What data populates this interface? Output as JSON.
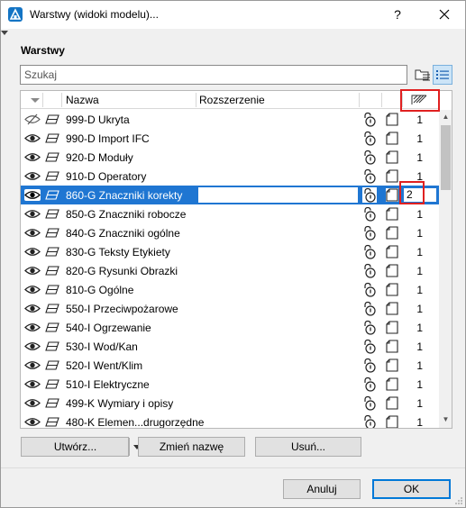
{
  "window": {
    "title": "Warstwy (widoki modelu)...",
    "help": "?",
    "close": "✕"
  },
  "section": {
    "label": "Warstwy"
  },
  "search": {
    "value": "Szukaj"
  },
  "table": {
    "columns": {
      "name": "Nazwa",
      "extension": "Rozszerzenie"
    },
    "rows": [
      {
        "name": "999-D Ukryta",
        "value": "1",
        "visible": false,
        "selected": false
      },
      {
        "name": "990-D Import IFC",
        "value": "1",
        "visible": true,
        "selected": false
      },
      {
        "name": "920-D Moduły",
        "value": "1",
        "visible": true,
        "selected": false
      },
      {
        "name": "910-D Operatory",
        "value": "1",
        "visible": true,
        "selected": false
      },
      {
        "name": "860-G Znaczniki korekty",
        "value": "2",
        "visible": true,
        "selected": true
      },
      {
        "name": "850-G Znaczniki robocze",
        "value": "1",
        "visible": true,
        "selected": false
      },
      {
        "name": "840-G Znaczniki ogólne",
        "value": "1",
        "visible": true,
        "selected": false
      },
      {
        "name": "830-G Teksty Etykiety",
        "value": "1",
        "visible": true,
        "selected": false
      },
      {
        "name": "820-G Rysunki Obrazki",
        "value": "1",
        "visible": true,
        "selected": false
      },
      {
        "name": "810-G Ogólne",
        "value": "1",
        "visible": true,
        "selected": false
      },
      {
        "name": "550-I Przeciwpożarowe",
        "value": "1",
        "visible": true,
        "selected": false
      },
      {
        "name": "540-I Ogrzewanie",
        "value": "1",
        "visible": true,
        "selected": false
      },
      {
        "name": "530-I Wod/Kan",
        "value": "1",
        "visible": true,
        "selected": false
      },
      {
        "name": "520-I Went/Klim",
        "value": "1",
        "visible": true,
        "selected": false
      },
      {
        "name": "510-I Elektryczne",
        "value": "1",
        "visible": true,
        "selected": false
      },
      {
        "name": "499-K Wymiary i opisy",
        "value": "1",
        "visible": true,
        "selected": false
      },
      {
        "name": "480-K Elemen...drugorzędne",
        "value": "1",
        "visible": true,
        "selected": false
      }
    ]
  },
  "buttons": {
    "create": "Utwórz...",
    "rename": "Zmień nazwę",
    "delete": "Usuń...",
    "cancel": "Anuluj",
    "ok": "OK"
  },
  "colors": {
    "selection": "#1f76d2",
    "highlight": "#e02020",
    "accent": "#0078d7"
  }
}
